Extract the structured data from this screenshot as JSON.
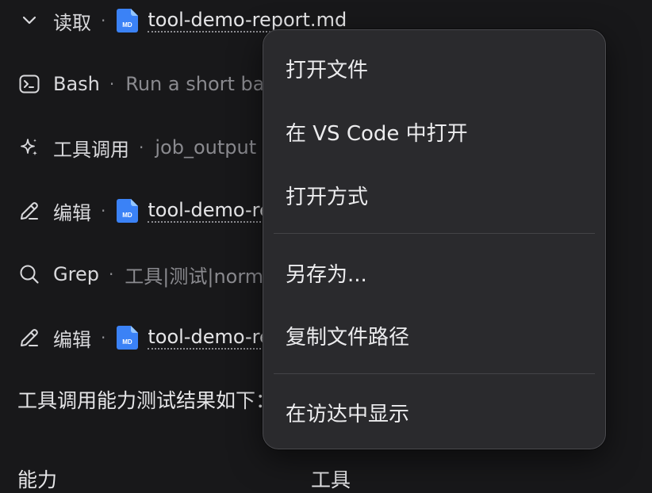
{
  "tool_calls": [
    {
      "label": "读取",
      "detail": "",
      "file": "tool-demo-report.md",
      "icon": "chevron-down-icon"
    },
    {
      "label": "Bash",
      "detail": "Run a short bash command",
      "file": "",
      "icon": "terminal-icon"
    },
    {
      "label": "工具调用",
      "detail": "job_output",
      "file": "",
      "icon": "sparkle-icon"
    },
    {
      "label": "编辑",
      "detail": "",
      "file": "tool-demo-report.md",
      "icon": "pencil-icon"
    },
    {
      "label": "Grep",
      "detail": "工具|测试|normal",
      "file": "",
      "icon": "search-icon"
    },
    {
      "label": "编辑",
      "detail": "",
      "file": "tool-demo-report.md",
      "icon": "pencil-icon"
    }
  ],
  "separator": "·",
  "file_badge": "MD",
  "summary_text": "工具调用能力测试结果如下：",
  "table_headers": [
    "能力",
    "工具"
  ],
  "context_menu": {
    "items": [
      "打开文件",
      "在 VS Code 中打开",
      "打开方式",
      "另存为...",
      "复制文件路径",
      "在访达中显示"
    ]
  },
  "colors": {
    "background": "#18181a",
    "menu_background": "#2a2a2d",
    "md_icon": "#3b82f6",
    "text": "#d9d9dc",
    "muted_text": "#8a8a8f"
  }
}
